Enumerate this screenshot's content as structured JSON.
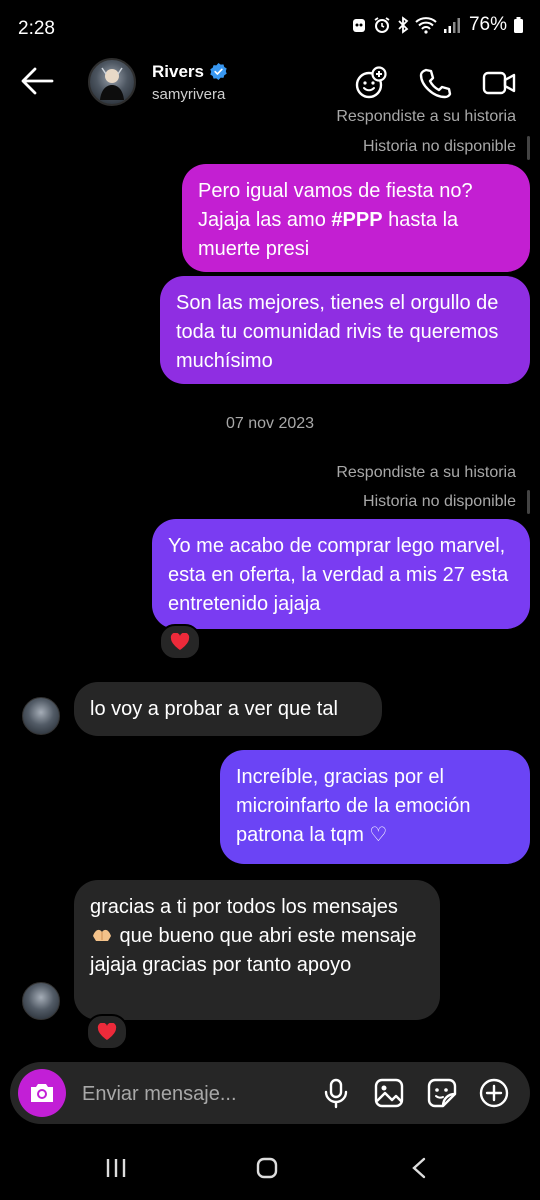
{
  "status": {
    "time": "2:28",
    "battery": "76%"
  },
  "header": {
    "name": "Rivers",
    "handle": "samyrivera"
  },
  "chat": {
    "meta_top_partial": "Respondiste a su historia",
    "meta_top_unavailable": "Historia no disponible",
    "msg1_line1": "Pero igual vamos de fiesta no?",
    "msg1_line2_pre": "Jajaja las amo ",
    "msg1_line2_bold": "#PPP",
    "msg1_line2_post": " hasta la",
    "msg1_line3": "muerte presi",
    "msg2": "Son las mejores, tienes el orgullo de toda tu comunidad rivis te queremos muchísimo",
    "date": "07 nov 2023",
    "meta_replied": "Respondiste a su historia",
    "meta_unavailable": "Historia no disponible",
    "msg3": "Yo me acabo de comprar lego marvel, esta en oferta, la verdad a mis 27 esta entretenido jajaja",
    "msg4": "lo voy a probar a ver que tal",
    "msg5": "Increíble, gracias por el microinfarto de la emoción patrona la tqm ♡",
    "msg6_pre": "gracias a ti por todos los mensajes ",
    "msg6_post": " que bueno que abri este mensaje jajaja gracias por tanto apoyo",
    "reaction": "❤️"
  },
  "composer": {
    "placeholder": "Enviar mensaje..."
  },
  "colors": {
    "bubble_magenta": "#c31fd2",
    "bubble_purple": "#7a3cf2",
    "incoming": "#262626",
    "camera": "#c21fd6"
  }
}
